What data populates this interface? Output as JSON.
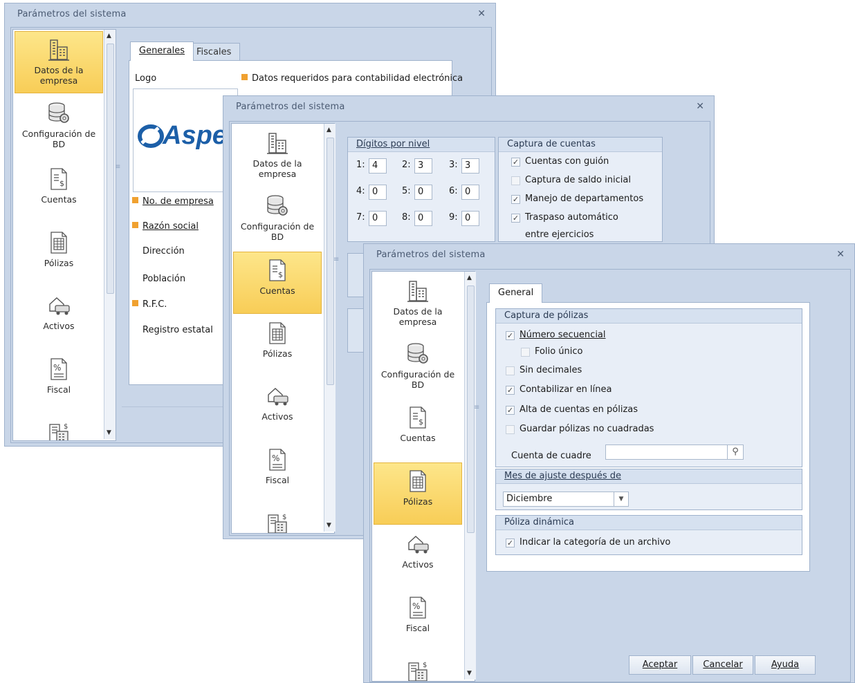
{
  "window1": {
    "title": "Parámetros del sistema",
    "close": "✕",
    "sidebar": [
      {
        "label": "Datos de la empresa",
        "icon": "building-icon"
      },
      {
        "label": "Configuración de BD",
        "icon": "database-gear-icon"
      },
      {
        "label": "Cuentas",
        "icon": "accounts-doc-icon"
      },
      {
        "label": "Pólizas",
        "icon": "policies-doc-icon"
      },
      {
        "label": "Activos",
        "icon": "assets-car-icon"
      },
      {
        "label": "Fiscal",
        "icon": "fiscal-percent-icon"
      }
    ],
    "tabs": [
      "Generales",
      "Fiscales"
    ],
    "logo_label": "Logo",
    "logo_text": "Aspel",
    "required_note": "Datos requeridos para contabilidad electrónica",
    "fields": [
      "No. de empresa",
      "Razón social",
      "Dirección",
      "Población",
      "R.F.C.",
      "Registro estatal"
    ]
  },
  "window2": {
    "title": "Parámetros del sistema",
    "close": "✕",
    "sidebar": [
      {
        "label": "Datos de la empresa",
        "icon": "building-icon"
      },
      {
        "label": "Configuración de BD",
        "icon": "database-gear-icon"
      },
      {
        "label": "Cuentas",
        "icon": "accounts-doc-icon"
      },
      {
        "label": "Pólizas",
        "icon": "policies-doc-icon"
      },
      {
        "label": "Activos",
        "icon": "assets-car-icon"
      },
      {
        "label": "Fiscal",
        "icon": "fiscal-percent-icon"
      }
    ],
    "digits_group": "Dígitos por nivel",
    "levels": [
      {
        "n": "1:",
        "v": "4"
      },
      {
        "n": "2:",
        "v": "3"
      },
      {
        "n": "3:",
        "v": "3"
      },
      {
        "n": "4:",
        "v": "0"
      },
      {
        "n": "5:",
        "v": "0"
      },
      {
        "n": "6:",
        "v": "0"
      },
      {
        "n": "7:",
        "v": "0"
      },
      {
        "n": "8:",
        "v": "0"
      },
      {
        "n": "9:",
        "v": "0"
      }
    ],
    "capture_group": "Captura de cuentas",
    "capture_options": [
      {
        "label": "Cuentas con guión",
        "checked": true
      },
      {
        "label": "Captura de saldo inicial",
        "checked": false
      },
      {
        "label": "Manejo de departamentos",
        "checked": true
      },
      {
        "label": "Traspaso automático",
        "checked": true
      }
    ],
    "capture_extra": "entre ejercicios"
  },
  "window3": {
    "title": "Parámetros del sistema",
    "close": "✕",
    "sidebar": [
      {
        "label": "Datos de la empresa",
        "icon": "building-icon"
      },
      {
        "label": "Configuración de BD",
        "icon": "database-gear-icon"
      },
      {
        "label": "Cuentas",
        "icon": "accounts-doc-icon"
      },
      {
        "label": "Pólizas",
        "icon": "policies-doc-icon"
      },
      {
        "label": "Activos",
        "icon": "assets-car-icon"
      },
      {
        "label": "Fiscal",
        "icon": "fiscal-percent-icon"
      }
    ],
    "tab": "General",
    "policy_group": "Captura de pólizas",
    "policy_options": [
      {
        "label": "Número secuencial",
        "checked": true
      },
      {
        "label": "Folio único",
        "checked": false
      },
      {
        "label": "Sin decimales",
        "checked": false
      },
      {
        "label": "Contabilizar en línea",
        "checked": true
      },
      {
        "label": "Alta de cuentas en pólizas",
        "checked": true
      },
      {
        "label": "Guardar pólizas no cuadradas",
        "checked": false
      }
    ],
    "cuadre_label": "Cuenta de cuadre",
    "cuadre_value": "",
    "month_group": "Mes de ajuste después de",
    "month_value": "Diciembre",
    "dynamic_group": "Póliza dinámica",
    "dynamic_option": {
      "label": "Indicar la categoría de un archivo",
      "checked": true
    },
    "buttons": [
      "Aceptar",
      "Cancelar",
      "Ayuda"
    ]
  }
}
